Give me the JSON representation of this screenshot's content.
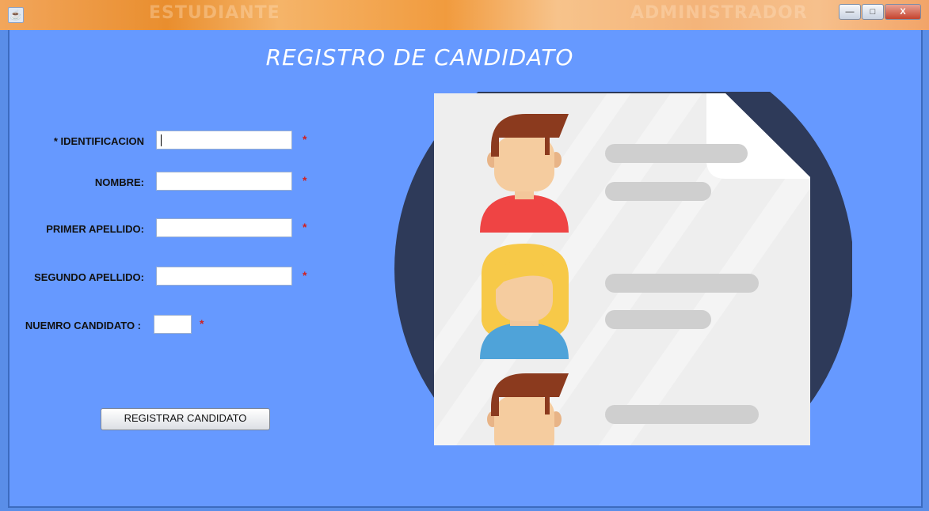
{
  "window": {
    "watermark_left": "ESTUDIANTE",
    "watermark_right": "ADMINISTRADOR",
    "buttons": {
      "minimize": "—",
      "maximize": "□",
      "close": "X"
    }
  },
  "form": {
    "title": "REGISTRO DE CANDIDATO",
    "fields": {
      "identificacion": {
        "label": "* IDENTIFICACION",
        "value": "",
        "required_mark": "*"
      },
      "nombre": {
        "label": "NOMBRE:",
        "value": "",
        "required_mark": "*"
      },
      "primer_apellido": {
        "label": "PRIMER APELLIDO:",
        "value": "",
        "required_mark": "*"
      },
      "segundo_apellido": {
        "label": "SEGUNDO APELLIDO:",
        "value": "",
        "required_mark": "*"
      },
      "numero_candidato": {
        "label": "NUEMRO CANDIDATO :",
        "value": "",
        "required_mark": "*"
      }
    },
    "submit_label": "REGISTRAR CANDIDATO"
  },
  "colors": {
    "background": "#6699ff",
    "required": "#d02020",
    "illustration_circle": "#2e3a59"
  }
}
